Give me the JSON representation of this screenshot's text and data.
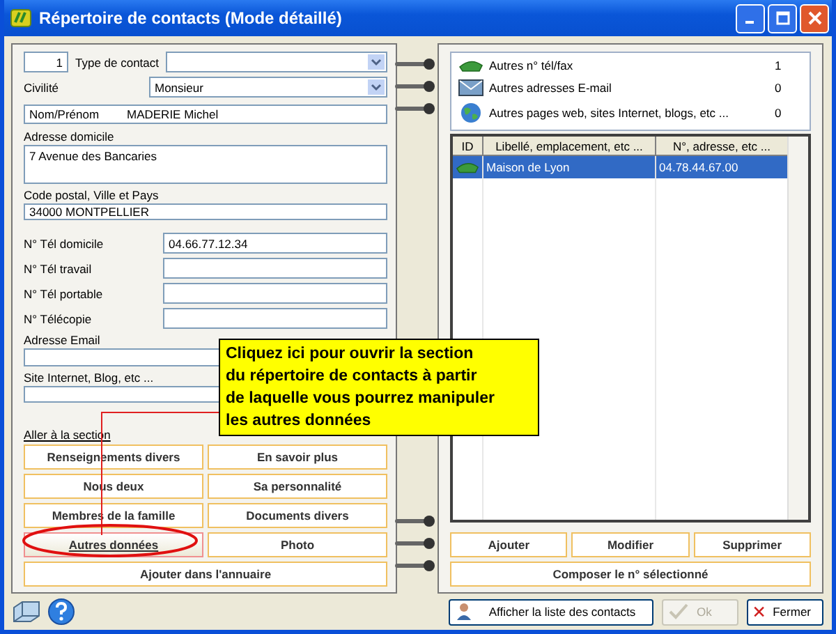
{
  "window": {
    "title": "Répertoire de contacts (Mode détaillé)"
  },
  "contact": {
    "number": "1",
    "type_label": "Type de contact",
    "civility_label": "Civilité",
    "civility_value": "Monsieur",
    "name_label": "Nom/Prénom",
    "name_value": "MADERIE Michel",
    "address_label": "Adresse domicile",
    "address_value": "7 Avenue des Bancaries",
    "postal_label": "Code postal, Ville et Pays",
    "postal_value": "34000 MONTPELLIER"
  },
  "phones": [
    {
      "label": "N° Tél domicile",
      "value": "04.66.77.12.34"
    },
    {
      "label": "N° Tél travail"
    },
    {
      "label": "N° Tél portable"
    },
    {
      "label": "N° Télécopie"
    }
  ],
  "email": {
    "label": "Adresse Email"
  },
  "website": {
    "label": "Site Internet, Blog, etc ..."
  },
  "sections": {
    "label": "Aller à la section",
    "buttons": [
      {
        "label": "Renseignements divers",
        "selected": false
      },
      {
        "label": "En savoir plus",
        "selected": false
      },
      {
        "label": "Nous deux",
        "selected": false
      },
      {
        "label": "Sa personnalité",
        "selected": false
      },
      {
        "label": "Membres de la famille",
        "selected": false
      },
      {
        "label": "Documents divers",
        "selected": false
      },
      {
        "label": "Autres données",
        "selected": true
      },
      {
        "label": "Photo",
        "selected": false
      }
    ],
    "wide_button": "Ajouter dans l'annuaire"
  },
  "callout": {
    "lines": [
      "Cliquez ici pour ouvrir la section",
      "du répertoire de contacts à partir",
      "de laquelle vous pourrez manipuler",
      "les autres données"
    ]
  },
  "summary": [
    {
      "kind": "phone",
      "label": "Autres n° tél/fax",
      "count": "1"
    },
    {
      "kind": "email",
      "label": "Autres adresses E-mail",
      "count": "0"
    },
    {
      "kind": "web",
      "label": "Autres pages web, sites Internet, blogs, etc ...",
      "count": "0"
    }
  ],
  "table": {
    "columns": [
      "ID",
      "Libellé, emplacement, etc ...",
      "N°, adresse, etc ..."
    ],
    "rows": [
      {
        "kind": "phone",
        "label": "Maison de Lyon",
        "value": "04.78.44.67.00",
        "selected": true
      }
    ]
  },
  "actions": [
    "Ajouter",
    "Modifier",
    "Supprimer"
  ],
  "compose": "Composer le n° sélectionné",
  "footer": [
    {
      "kind": "contacts",
      "label": "Afficher la liste des contacts",
      "disabled": false
    },
    {
      "kind": "ok",
      "label": "Ok",
      "disabled": true
    },
    {
      "kind": "close",
      "label": "Fermer",
      "disabled": false
    }
  ]
}
